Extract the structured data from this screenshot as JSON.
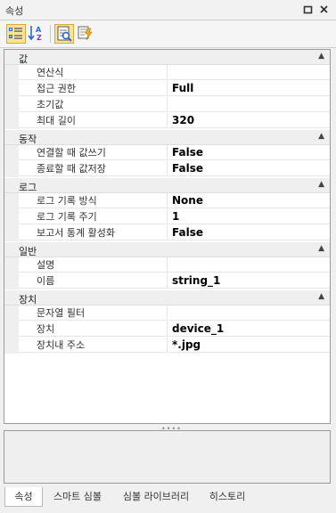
{
  "panel": {
    "title": "속성"
  },
  "categories": [
    {
      "name": "값",
      "properties": [
        {
          "name": "연산식",
          "value": ""
        },
        {
          "name": "접근 권한",
          "value": "Full"
        },
        {
          "name": "초기값",
          "value": ""
        },
        {
          "name": "최대 길이",
          "value": "320"
        }
      ]
    },
    {
      "name": "동작",
      "properties": [
        {
          "name": "연결할 때 값쓰기",
          "value": "False"
        },
        {
          "name": "종료할 때 값저장",
          "value": "False"
        }
      ]
    },
    {
      "name": "로그",
      "properties": [
        {
          "name": "로그 기록 방식",
          "value": "None"
        },
        {
          "name": "로그 기록 주기",
          "value": "1"
        },
        {
          "name": "보고서 통계 활성화",
          "value": "False"
        }
      ]
    },
    {
      "name": "일반",
      "properties": [
        {
          "name": "설명",
          "value": ""
        },
        {
          "name": "이름",
          "value": "string_1"
        }
      ]
    },
    {
      "name": "장치",
      "properties": [
        {
          "name": "문자열 필터",
          "value": ""
        },
        {
          "name": "장치",
          "value": "device_1"
        },
        {
          "name": "장치내 주소",
          "value": "*.jpg"
        }
      ]
    }
  ],
  "tabs": [
    "속성",
    "스마트 심볼",
    "심볼 라이브러리",
    "히스토리"
  ],
  "icons": {
    "categorized": "categorized-view-icon",
    "alphabetical": "alphabetical-sort-icon",
    "properties": "properties-icon",
    "events": "events-icon",
    "restore": "restore-window-icon",
    "close": "close-icon",
    "collapse": "chevron-up-icon"
  },
  "colors": {
    "active_button": "#f7e49a",
    "category_bg": "#efefef",
    "grid_border": "#9a9a9a"
  }
}
